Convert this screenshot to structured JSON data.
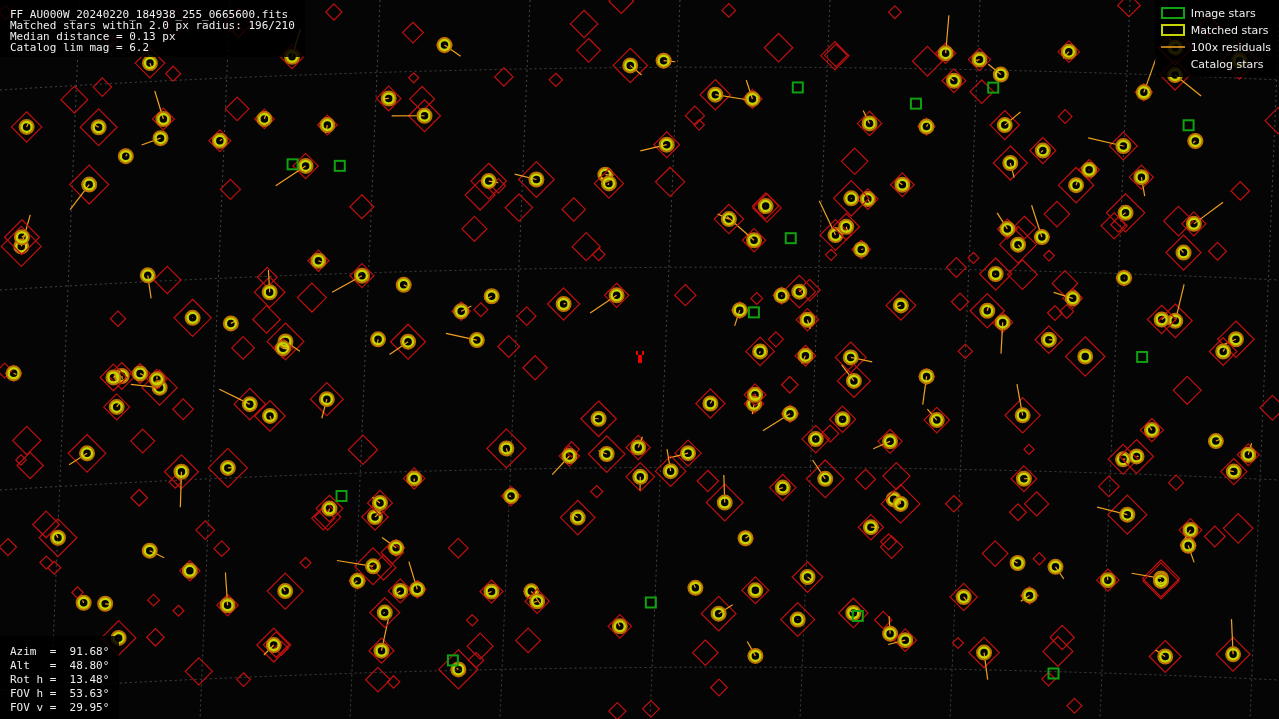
{
  "image_info": {
    "lines": [
      "FF_AU000W_20240220_184938_255_0665600.fits",
      "Matched stars within 2.0 px radius: 196/210",
      "Median distance = 0.13 px",
      "Catalog lim mag = 6.2"
    ]
  },
  "legend": {
    "items": [
      {
        "kind": "image",
        "label": "Image stars"
      },
      {
        "kind": "matched",
        "label": "Matched stars"
      },
      {
        "kind": "residual",
        "label": "100x residuals"
      },
      {
        "kind": "catalog",
        "label": "Catalog stars"
      }
    ]
  },
  "pointing_info": {
    "lines": [
      "Azim  =  91.68°",
      "Alt   =  48.80°",
      "Rot h =  13.48°",
      "FOV h =  53.63°",
      "FOV v =  29.95°"
    ]
  }
}
